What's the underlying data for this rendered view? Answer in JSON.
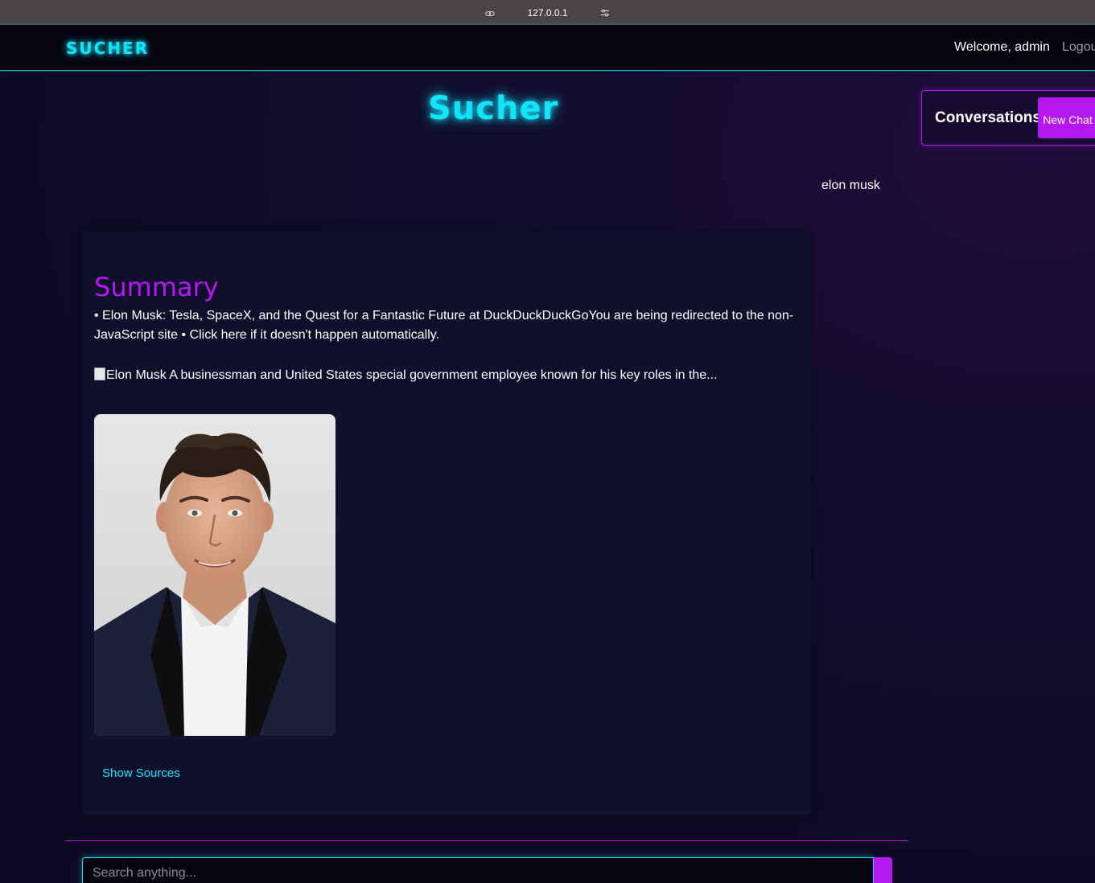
{
  "browser": {
    "url": "127.0.0.1",
    "icons": [
      "link-icon",
      "tune-icon"
    ]
  },
  "nav": {
    "brand": "SUCHER",
    "welcome": "Welcome, admin",
    "logout": "Logout"
  },
  "hero": {
    "title": "Sucher"
  },
  "conversations": {
    "title": "Conversations",
    "new_chat_label": "New Chat"
  },
  "chat": {
    "user_query": "elon musk",
    "summary_heading": "Summary",
    "summary_text": "• Elon Musk: Tesla, SpaceX, and the Quest for a Fantastic Future at DuckDuckDuckGoYou are being redirected to the non-JavaScript site • Click here if it doesn't happen automatically.",
    "image_alt_text": "Elon Musk A businessman and United States special government employee known for his key roles in the...",
    "show_sources_label": "Show Sources"
  },
  "search": {
    "placeholder": "Search anything...",
    "value": ""
  },
  "colors": {
    "accent_cyan": "#14e3f7",
    "accent_purple": "#b417f0",
    "background": "#0d0b24"
  }
}
